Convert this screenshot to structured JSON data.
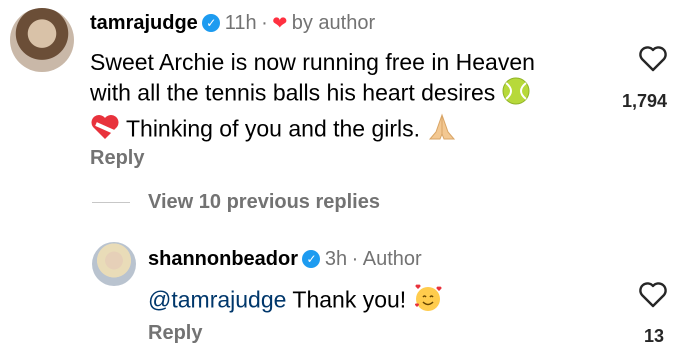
{
  "comment": {
    "username": "tamrajudge",
    "time": "11h",
    "dot": "·",
    "liked_by": "by author",
    "line1": "Sweet Archie is now running free in Heaven",
    "line2": "with all the tennis balls his heart desires",
    "line3": "Thinking of you and the girls.",
    "reply_label": "Reply",
    "like_count": "1,794"
  },
  "view_replies": {
    "label": "View 10 previous replies"
  },
  "reply": {
    "username": "shannonbeador",
    "time": "3h",
    "dot": "·",
    "author_label": "Author",
    "mention": "@tamrajudge",
    "text": "Thank you!",
    "reply_label": "Reply",
    "like_count": "13"
  },
  "colors": {
    "verified": "#1d9bf0",
    "heart_red": "#ff3040",
    "muted": "#737373",
    "mention": "#00376b"
  }
}
